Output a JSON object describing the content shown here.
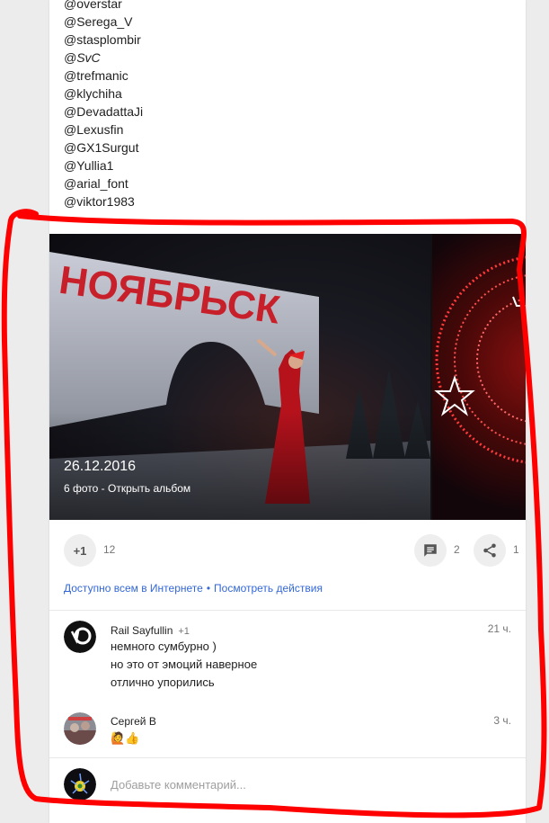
{
  "mentions": [
    "@overstar",
    "@Serega_V",
    "@stasplombir",
    "@SvC",
    "@trefmanic",
    "@klychiha",
    "@DevadattaJi",
    "@Lexusfin",
    "@GX1Surgut",
    "@Yullia1",
    "@arial_font",
    "@viktor1983"
  ],
  "album": {
    "sign_text": "НОЯБРЬСК",
    "date": "26.12.2016",
    "link": "6 фото - Открыть альбом"
  },
  "actions": {
    "plus_label": "+1",
    "plus_count": "12",
    "comments_count": "2",
    "shares_count": "1"
  },
  "visibility": {
    "public": "Доступно всем в Интернете",
    "separator": "•",
    "view_activity": "Посмотреть действия"
  },
  "comments": [
    {
      "author": "Rail Sayfullin",
      "plus": "+1",
      "time": "21 ч.",
      "lines": [
        "немного сумбурно )",
        "но это от эмоций наверное",
        "отлично упорились"
      ]
    },
    {
      "author": "Сергей В",
      "time": "3 ч.",
      "lines": [
        "🙋👍"
      ]
    }
  ],
  "add_comment": {
    "placeholder": "Добавьте комментарий..."
  },
  "colors": {
    "link": "#3367d6",
    "annotation": "#ff0000"
  }
}
